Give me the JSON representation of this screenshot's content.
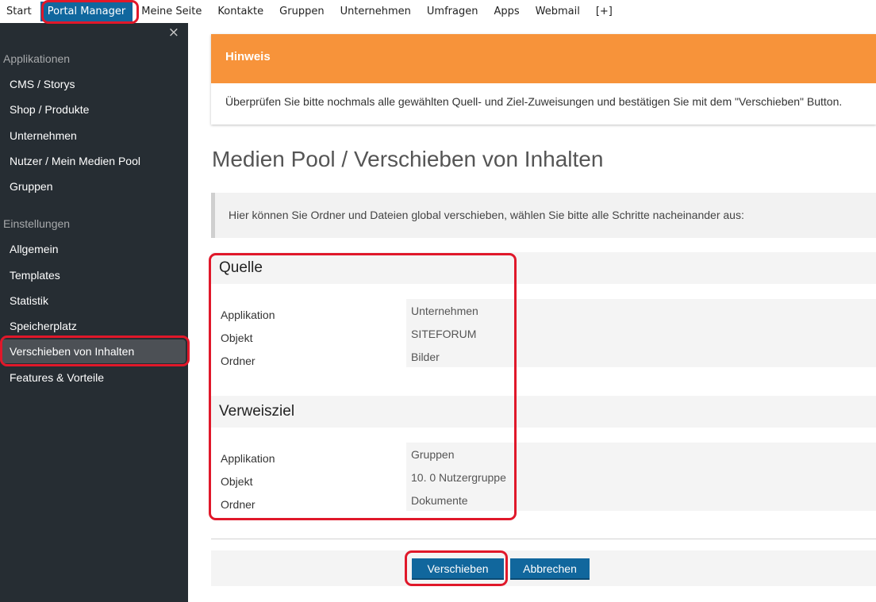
{
  "topnav": {
    "items": [
      "Start",
      "Portal Manager",
      "Meine Seite",
      "Kontakte",
      "Gruppen",
      "Unternehmen",
      "Umfragen",
      "Apps",
      "Webmail",
      "[+]"
    ],
    "active": "Portal Manager"
  },
  "sidebar": {
    "close_icon": "×",
    "section_apps": "Applikationen",
    "apps": [
      "CMS / Storys",
      "Shop / Produkte",
      "Unternehmen",
      "Nutzer / Mein Medien Pool",
      "Gruppen"
    ],
    "section_settings": "Einstellungen",
    "settings": [
      "Allgemein",
      "Templates",
      "Statistik",
      "Speicherplatz",
      "Verschieben von Inhalten",
      "Features & Vorteile"
    ],
    "active": "Verschieben von Inhalten"
  },
  "hinweis": {
    "title": "Hinweis",
    "text": "Überprüfen Sie bitte nochmals alle gewählten Quell- und Ziel-Zuweisungen und bestätigen Sie mit dem \"Verschieben\" Button."
  },
  "page": {
    "title": "Medien Pool / Verschieben von Inhalten",
    "info": "Hier können Sie Ordner und Dateien global verschieben, wählen Sie bitte alle Schritte nacheinander aus:"
  },
  "quelle": {
    "title": "Quelle",
    "labels": [
      "Applikation",
      "Objekt",
      "Ordner"
    ],
    "values": [
      "Unternehmen",
      "SITEFORUM",
      "Bilder"
    ]
  },
  "verweisziel": {
    "title": "Verweisziel",
    "labels": [
      "Applikation",
      "Objekt",
      "Ordner"
    ],
    "values": [
      "Gruppen",
      "10. 0 Nutzergruppe",
      "Dokumente"
    ]
  },
  "buttons": {
    "move": "Verschieben",
    "cancel": "Abbrechen"
  },
  "colors": {
    "accent": "#10679e",
    "sidebar_bg": "#262d33",
    "hinweis_bg": "#f7933a",
    "highlight": "#e0182a"
  }
}
